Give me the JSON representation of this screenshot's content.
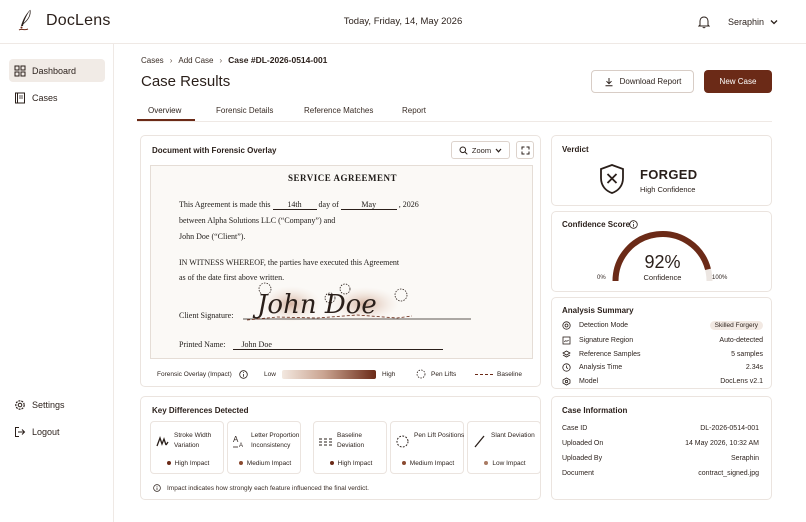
{
  "app": {
    "name": "DocLens"
  },
  "header": {
    "date": "Today, Friday, 14, May 2026",
    "user": "Seraphin"
  },
  "sidebar": {
    "items": [
      {
        "label": "Dashboard",
        "icon": "dashboard-icon"
      },
      {
        "label": "Cases",
        "icon": "cases-icon"
      }
    ],
    "bottom": [
      {
        "label": "Settings",
        "icon": "gear-icon"
      },
      {
        "label": "Logout",
        "icon": "logout-icon"
      }
    ]
  },
  "breadcrumb": [
    "Cases",
    "Add Case",
    "Case #DL-2026-0514-001"
  ],
  "page": {
    "title": "Case Results",
    "download_label": "Download Report",
    "new_case_label": "New Case"
  },
  "tabs": [
    "Overview",
    "Forensic Details",
    "Reference Matches",
    "Report"
  ],
  "document": {
    "title": "Document with Forensic Overlay",
    "zoom_label": "Zoom",
    "paper": {
      "heading": "SERVICE AGREEMENT",
      "line1_a": "This Agreement is made this",
      "day": "14th",
      "line1_b": "day of",
      "month": "May",
      "line1_c": ", 2026",
      "line2": "between Alpha Solutions LLC (“Company”) and",
      "line3": "John Doe (“Client”).",
      "line4": "IN WITNESS WHEREOF, the parties have executed this Agreement",
      "line5": "as of the date first above written.",
      "sig_label": "Client Signature:",
      "signature": "John Doe",
      "printed_label": "Printed Name:",
      "printed_name": "John Doe"
    },
    "legend": {
      "title": "Forensic Overlay (Impact)",
      "low": "Low",
      "high": "High",
      "pen_lifts": "Pen Lifts",
      "baseline": "Baseline"
    }
  },
  "verdict": {
    "title": "Verdict",
    "result": "FORGED",
    "confidence_text": "High Confidence"
  },
  "confidence": {
    "title": "Confidence Score",
    "value": "92%",
    "percent": 92,
    "label": "Confidence",
    "min": "0%",
    "max": "100%"
  },
  "summary": {
    "title": "Analysis Summary",
    "rows": [
      {
        "label": "Detection Mode",
        "value": "Skilled Forgery"
      },
      {
        "label": "Signature Region",
        "value": "Auto-detected"
      },
      {
        "label": "Reference Samples",
        "value": "5 samples"
      },
      {
        "label": "Analysis Time",
        "value": "2.34s"
      },
      {
        "label": "Model",
        "value": "DocLens v2.1"
      }
    ]
  },
  "differences": {
    "title": "Key Differences Detected",
    "items": [
      {
        "name": "Stroke Width Variation",
        "impact": "High Impact",
        "color": "#6b2a17"
      },
      {
        "name": "Letter Proportion Inconsistency",
        "impact": "Medium Impact",
        "color": "#8a4a30"
      },
      {
        "name": "Baseline Deviation",
        "impact": "High Impact",
        "color": "#6b2a17"
      },
      {
        "name": "Pen Lift Positions",
        "impact": "Medium Impact",
        "color": "#8a4a30"
      },
      {
        "name": "Slant Deviation",
        "impact": "Low Impact",
        "color": "#a97b63"
      }
    ],
    "note": "Impact indicates how strongly each feature influenced the final verdict."
  },
  "case_info": {
    "title": "Case Information",
    "rows": [
      {
        "label": "Case ID",
        "value": "DL-2026-0514-001"
      },
      {
        "label": "Uploaded On",
        "value": "14 May 2026,  10:32 AM"
      },
      {
        "label": "Uploaded By",
        "value": "Seraphin"
      },
      {
        "label": "Document",
        "value": "contract_signed.jpg"
      }
    ]
  },
  "colors": {
    "accent": "#6b2a17",
    "border": "#ebe4df",
    "active_bg": "#f1ebe6"
  }
}
